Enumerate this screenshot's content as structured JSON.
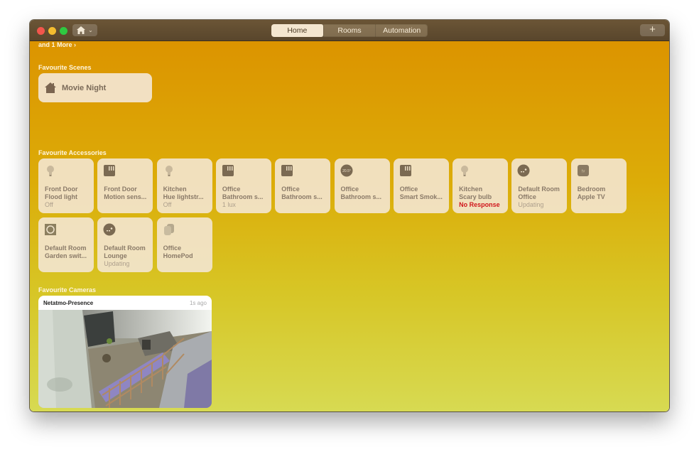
{
  "window": {
    "tabs": [
      {
        "label": "Home",
        "active": true
      },
      {
        "label": "Rooms",
        "active": false
      },
      {
        "label": "Automation",
        "active": false
      }
    ],
    "add_label": "+"
  },
  "content": {
    "more_link": "and 1 More ›",
    "scenes": {
      "title": "Favourite Scenes",
      "items": [
        {
          "label": "Movie Night",
          "icon": "house-icon"
        }
      ]
    },
    "accessories": {
      "title": "Favourite Accessories",
      "items": [
        {
          "room": "Front Door",
          "name": "Flood light",
          "status": "Off",
          "icon": "lightbulb-icon"
        },
        {
          "room": "Front Door",
          "name": "Motion sens...",
          "status": "",
          "icon": "sensor-icon"
        },
        {
          "room": "Kitchen",
          "name": "Hue lightstr...",
          "status": "Off",
          "icon": "lightbulb-icon"
        },
        {
          "room": "Office",
          "name": "Bathroom s...",
          "status": "1 lux",
          "icon": "sensor-icon"
        },
        {
          "room": "Office",
          "name": "Bathroom s...",
          "status": "",
          "icon": "sensor-icon"
        },
        {
          "room": "Office",
          "name": "Bathroom s...",
          "status": "",
          "icon": "thermometer-icon",
          "reading": "20.5°"
        },
        {
          "room": "Office",
          "name": "Smart Smok...",
          "status": "",
          "icon": "sensor-icon"
        },
        {
          "room": "Kitchen",
          "name": "Scary bulb",
          "status": "No Response",
          "alert": true,
          "icon": "lightbulb-icon"
        },
        {
          "room": "Default Room",
          "name": "Office",
          "status": "Updating",
          "icon": "bridge-icon"
        },
        {
          "room": "Bedroom",
          "name": "Apple TV",
          "status": "",
          "icon": "apple-tv-icon",
          "reading": "tv"
        },
        {
          "room": "Default Room",
          "name": "Garden swit...",
          "status": "",
          "icon": "switch-icon"
        },
        {
          "room": "Default Room",
          "name": "Lounge",
          "status": "Updating",
          "icon": "bridge-icon"
        },
        {
          "room": "Office",
          "name": "HomePod",
          "status": "",
          "icon": "homepod-icon"
        }
      ]
    },
    "cameras": {
      "title": "Favourite Cameras",
      "items": [
        {
          "name": "Netatmo-Presence",
          "time": "1s ago"
        }
      ]
    }
  }
}
